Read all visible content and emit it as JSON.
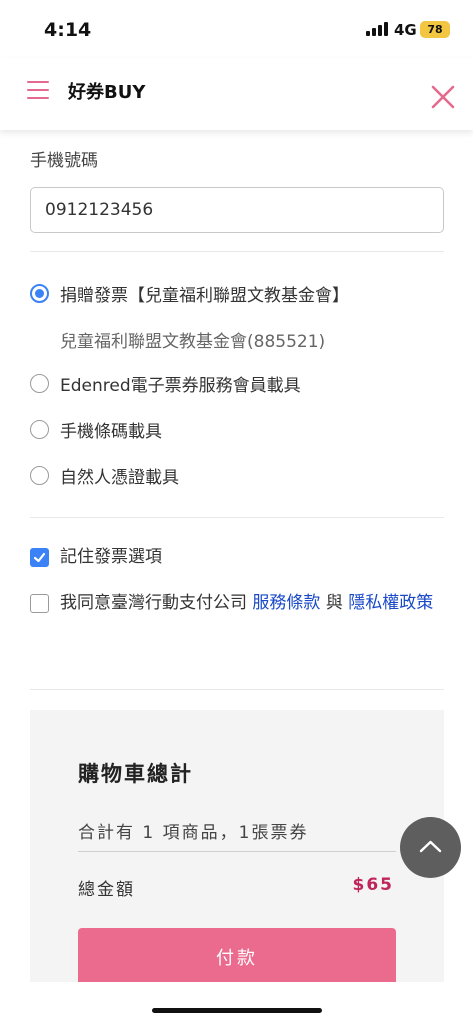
{
  "status_bar": {
    "time": "4:14",
    "network": "4G",
    "battery": "78"
  },
  "header": {
    "title": "好券BUY",
    "menu_icon": "hamburger-menu-icon",
    "close_icon": "close-icon",
    "accent_color": "#e36b8e"
  },
  "form": {
    "phone_label": "手機號碼",
    "phone_value": "0912123456"
  },
  "invoice_options": [
    {
      "label": "捐贈發票【兒童福利聯盟文教基金會】",
      "selected": true
    },
    {
      "label": "Edenred電子票券服務會員載具",
      "selected": false
    },
    {
      "label": "手機條碼載具",
      "selected": false
    },
    {
      "label": "自然人憑證載具",
      "selected": false
    }
  ],
  "donation_detail": "兒童福利聯盟文教基金會(885521)",
  "remember": {
    "label": "記住發票選項",
    "checked": true
  },
  "agreement": {
    "prefix": "我同意臺灣行動支付公司",
    "terms_link": "服務條款",
    "joiner": "與",
    "privacy_link": "隱私權政策",
    "checked": false
  },
  "cart_summary": {
    "title": "購物車總計",
    "count_text": "合計有 1 項商品，1張票券",
    "total_label": "總金額",
    "total_value": "$65",
    "pay_button": "付款",
    "pay_button_color": "#eb6b8f",
    "total_color": "#c0245c"
  },
  "floating": {
    "scroll_top_icon": "chevron-up-icon"
  }
}
